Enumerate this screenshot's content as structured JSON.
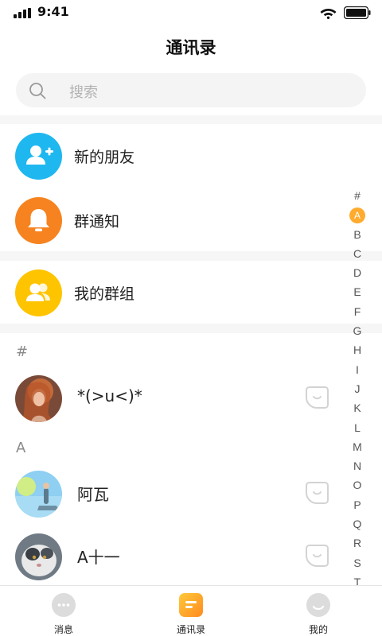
{
  "status_bar": {
    "time": "9:41"
  },
  "header": {
    "title": "通讯录"
  },
  "search": {
    "placeholder": "搜索"
  },
  "menu": [
    {
      "label": "新的朋友",
      "icon": "add-friend-icon",
      "color": "#1fb7f0"
    },
    {
      "label": "群通知",
      "icon": "bell-icon",
      "color": "#f6831f"
    },
    {
      "label": "我的群组",
      "icon": "group-icon",
      "color": "#ffc400"
    }
  ],
  "sections": [
    {
      "letter": "#",
      "contacts": [
        {
          "name": "*(>u<)*"
        }
      ]
    },
    {
      "letter": "A",
      "contacts": [
        {
          "name": "阿瓦"
        },
        {
          "name": "A十一"
        }
      ]
    }
  ],
  "index_letters": [
    "#",
    "A",
    "B",
    "C",
    "D",
    "E",
    "F",
    "G",
    "H",
    "I",
    "J",
    "K",
    "L",
    "M",
    "N",
    "O",
    "P",
    "Q",
    "R",
    "S",
    "T"
  ],
  "index_active": "A",
  "tabs": [
    {
      "label": "消息",
      "icon": "chat-bubble-icon"
    },
    {
      "label": "通讯录",
      "icon": "contacts-icon",
      "active": true
    },
    {
      "label": "我的",
      "icon": "profile-icon"
    }
  ],
  "colors": {
    "accent": "#ffab2e",
    "divider": "#f6f6f6"
  }
}
